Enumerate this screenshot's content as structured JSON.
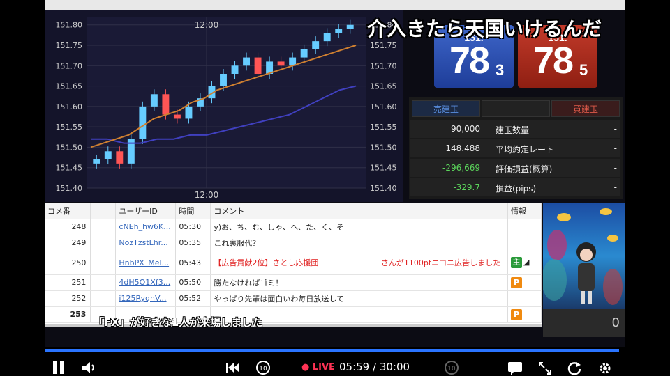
{
  "headline": "介入きたら天国いけるんだ",
  "quotes": {
    "sell": {
      "prefix": "151.",
      "big": "78",
      "sub": "3",
      "color": "#2a4fb0"
    },
    "buy": {
      "prefix": "151.",
      "big": "78",
      "sub": "5",
      "color": "#a52a1a"
    }
  },
  "positions": {
    "header": [
      "売建玉",
      "",
      "買建玉"
    ],
    "rows": [
      {
        "value": "90,000",
        "label": "建玉数量",
        "right": "-"
      },
      {
        "value": "148.488",
        "label": "平均約定レート",
        "right": "-"
      },
      {
        "value": "-296,669",
        "label": "評価損益(概算)",
        "right": "-"
      },
      {
        "value": "-329.7",
        "label": "損益(pips)",
        "right": "-"
      }
    ]
  },
  "comments": {
    "headers": [
      "コメ番",
      "",
      "ユーザーID",
      "時間",
      "コメント",
      "情報"
    ],
    "rows": [
      {
        "no": "248",
        "uid": "cNEh_hw6K...",
        "time": "05:30",
        "text": "y)お、ち、む、しゃ、へ、た、く、そ",
        "badge": ""
      },
      {
        "no": "249",
        "uid": "NozTzstLhr...",
        "time": "05:35",
        "text": "これ裏服代？",
        "badge": ""
      },
      {
        "no": "250",
        "uid": "HnbPX_Mel...",
        "time": "05:43",
        "text": "【広告貢献2位】さとし応援団",
        "text2": "さんが1100ptニコニ広告しました",
        "badge": "主"
      },
      {
        "no": "251",
        "uid": "4dH5O1Xf3...",
        "time": "05:50",
        "text": "勝たなければゴミ！",
        "badge": "P"
      },
      {
        "no": "252",
        "uid": "i125RyqnV...",
        "time": "05:52",
        "text": "やっぱり先輩は面白いわ毎日放送して",
        "badge": ""
      },
      {
        "no": "253",
        "uid": "",
        "time": "",
        "text": "",
        "badge": "P"
      }
    ]
  },
  "join_message": "「FX」が好きな1人が来場しました",
  "viewer_count": "0",
  "player": {
    "live": "LIVE",
    "time": "05:59 / 30:00"
  },
  "chart_data": {
    "type": "candlestick",
    "time_labels": [
      "12:00"
    ],
    "yticks": [
      "151.80",
      "151.75",
      "151.70",
      "151.65",
      "151.60",
      "151.55",
      "151.50",
      "151.45",
      "151.40"
    ],
    "ylim": [
      151.4,
      151.82
    ],
    "close_series": [
      151.47,
      151.49,
      151.46,
      151.52,
      151.6,
      151.63,
      151.58,
      151.57,
      151.6,
      151.62,
      151.65,
      151.68,
      151.7,
      151.72,
      151.68,
      151.71,
      151.7,
      151.72,
      151.74,
      151.76,
      151.78,
      151.79,
      151.8
    ],
    "ma_short": [
      151.5,
      151.51,
      151.52,
      151.53,
      151.55,
      151.57,
      151.58,
      151.59,
      151.61,
      151.62,
      151.64,
      151.65,
      151.66,
      151.67,
      151.68,
      151.69,
      151.7,
      151.71,
      151.72,
      151.73,
      151.74,
      151.75
    ],
    "ma_long": [
      151.52,
      151.52,
      151.51,
      151.51,
      151.52,
      151.52,
      151.53,
      151.53,
      151.54,
      151.55,
      151.56,
      151.57,
      151.58,
      151.6,
      151.62,
      151.64,
      151.65
    ],
    "colors": {
      "up": "#66ccff",
      "down": "#ff5555",
      "ma_short": "#d08030",
      "ma_long": "#4040c0",
      "bg": "#14142a",
      "grid": "#303048"
    }
  }
}
